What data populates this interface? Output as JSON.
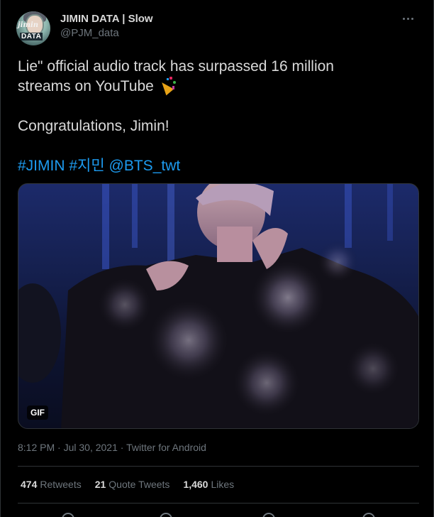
{
  "tweet": {
    "display_name": "JIMIN DATA | Slow",
    "handle": "@PJM_data",
    "avatar_logo_top": "jimin",
    "avatar_logo_bottom": "DATA",
    "text_line1": "Lie\" official audio track has surpassed 16 million",
    "text_line2": "streams on YouTube",
    "text_line3": "Congratulations, Jimin!",
    "hashtag1": "#JIMIN",
    "hashtag2": "#지민",
    "mention": "@BTS_twt",
    "gif_label": "GIF",
    "time": "8:12 PM",
    "date": "Jul 30, 2021",
    "separator": " · ",
    "client": "Twitter for Android"
  },
  "stats": {
    "retweets_count": "474",
    "retweets_label": "Retweets",
    "quotes_count": "21",
    "quotes_label": "Quote Tweets",
    "likes_count": "1,460",
    "likes_label": "Likes"
  },
  "icons": {
    "more": "more-horizontal-icon",
    "emoji": "party-popper-icon",
    "actions": [
      "reply-icon",
      "retweet-icon",
      "like-icon",
      "share-icon"
    ]
  },
  "colors": {
    "background": "#000000",
    "text": "#d9d9d9",
    "secondary": "#6e767d",
    "accent": "#1d9bf0",
    "border": "#2f3336"
  }
}
